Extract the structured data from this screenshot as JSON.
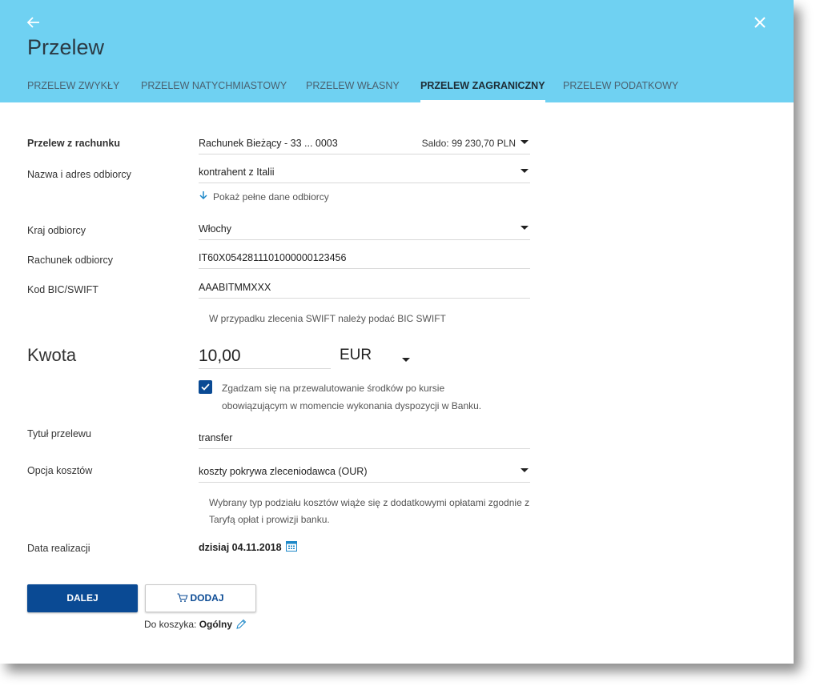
{
  "header": {
    "title": "Przelew",
    "tabs": [
      {
        "label": "PRZELEW ZWYKŁY",
        "active": false
      },
      {
        "label": "PRZELEW NATYCHMIASTOWY",
        "active": false
      },
      {
        "label": "PRZELEW WŁASNY",
        "active": false
      },
      {
        "label": "PRZELEW ZAGRANICZNY",
        "active": true
      },
      {
        "label": "PRZELEW PODATKOWY",
        "active": false
      }
    ],
    "back_icon": "arrow-left-icon",
    "close_icon": "close-icon",
    "background_color": "#6fd1f2"
  },
  "form": {
    "from_account": {
      "label": "Przelew z rachunku",
      "value": "Rachunek Bieżący - 33 ... 0003",
      "balance": "Saldo: 99 230,70 PLN"
    },
    "recipient": {
      "label": "Nazwa i adres odbiorcy",
      "value": "kontrahent z Italii",
      "show_details_link": "Pokaż pełne dane odbiorcy"
    },
    "country": {
      "label": "Kraj odbiorcy",
      "value": "Włochy"
    },
    "recipient_account": {
      "label": "Rachunek odbiorcy",
      "value": "IT60X0542811101000000123456"
    },
    "bic": {
      "label": "Kod BIC/SWIFT",
      "value": "AAABITMMXXX",
      "hint": "W przypadku zlecenia SWIFT należy podać BIC SWIFT"
    },
    "amount": {
      "label": "Kwota",
      "value": "10,00",
      "currency": "EUR"
    },
    "conversion_consent": {
      "checked": true,
      "text": "Zgadzam się na przewalutowanie środków po kursie obowiązującym w momencie wykonania dyspozycji w Banku."
    },
    "title": {
      "label": "Tytuł przelewu",
      "value": "transfer"
    },
    "costs": {
      "label": "Opcja kosztów",
      "value": "koszty pokrywa zleceniodawca (OUR)",
      "hint": "Wybrany typ podziału kosztów wiąże się z dodatkowymi opłatami zgodnie z Taryfą opłat i prowizji banku."
    },
    "date": {
      "label": "Data realizacji",
      "value": "dzisiaj 04.11.2018"
    }
  },
  "actions": {
    "next_label": "DALEJ",
    "add_label": "DODAJ",
    "basket_label": "Do koszyka:",
    "basket_value": "Ogólny"
  },
  "colors": {
    "accent": "#0a4a94",
    "link": "#1e88c8"
  }
}
